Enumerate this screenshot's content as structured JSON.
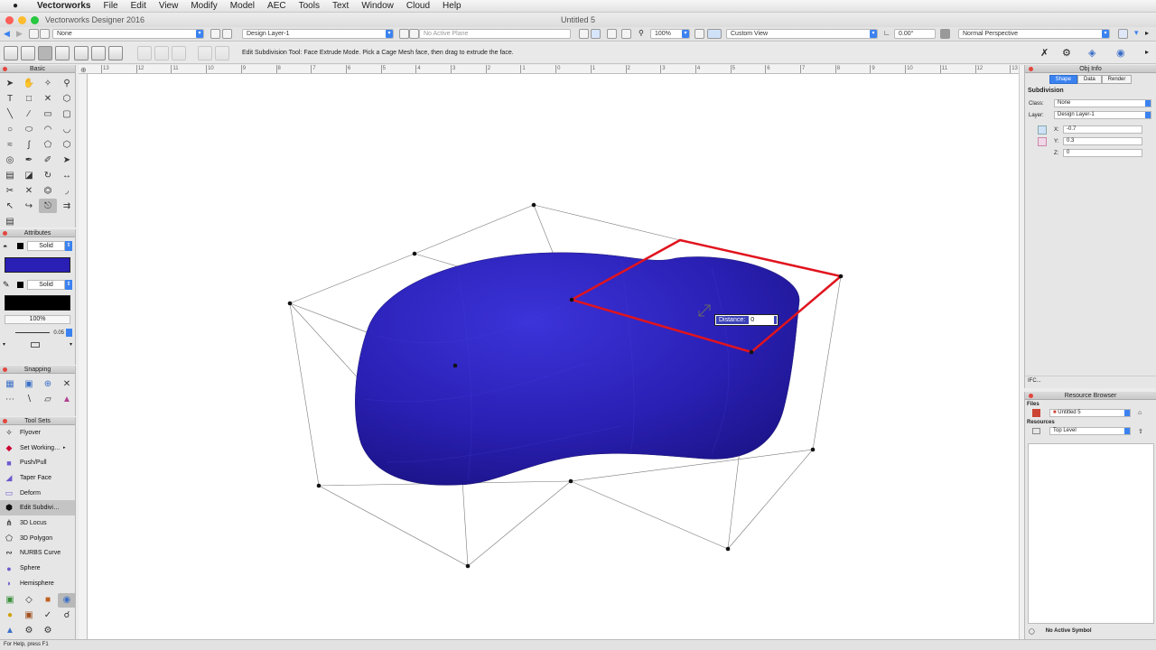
{
  "menubar": {
    "apple": "",
    "app_name": "Vectorworks",
    "items": [
      "File",
      "Edit",
      "View",
      "Modify",
      "Model",
      "AEC",
      "Tools",
      "Text",
      "Window",
      "Cloud",
      "Help"
    ]
  },
  "window": {
    "app_title": "Vectorworks Designer 2016",
    "doc_title": "Untitled 5"
  },
  "viewbar": {
    "class_value": "None",
    "layer_value": "Design Layer-1",
    "plane_value": "No Active Plane",
    "zoom_value": "100%",
    "view_value": "Custom View",
    "angle_value": "0.00°",
    "render_value": "Normal Perspective"
  },
  "modebar": {
    "message": "Edit Subdivision Tool: Face Extrude Mode. Pick a Cage Mesh face, then drag to extrude the face."
  },
  "palettes": {
    "basic_title": "Basic",
    "attributes_title": "Attributes",
    "fill_style": "Solid",
    "pen_style": "Solid",
    "opacity": "100%",
    "line_thickness": "0.05",
    "fill_color": "#2a1fb5",
    "pen_color": "#000000",
    "snapping_title": "Snapping",
    "toolsets_title": "Tool Sets",
    "toolsets": [
      {
        "label": "Flyover",
        "icon": "flyover-icon"
      },
      {
        "label": "Set Working…",
        "icon": "working-plane-icon"
      },
      {
        "label": "Push/Pull",
        "icon": "push-pull-icon"
      },
      {
        "label": "Taper Face",
        "icon": "taper-face-icon"
      },
      {
        "label": "Deform",
        "icon": "deform-icon"
      },
      {
        "label": "Edit Subdivi…",
        "icon": "edit-subdivision-icon"
      },
      {
        "label": "3D Locus",
        "icon": "locus-icon"
      },
      {
        "label": "3D Polygon",
        "icon": "polygon-3d-icon"
      },
      {
        "label": "NURBS Curve",
        "icon": "nurbs-curve-icon"
      },
      {
        "label": "Sphere",
        "icon": "sphere-icon"
      },
      {
        "label": "Hemisphere",
        "icon": "hemisphere-icon"
      }
    ]
  },
  "rulers": {
    "h_ticks": [
      "13",
      "12",
      "11",
      "10",
      "9",
      "8",
      "7",
      "6",
      "5",
      "4",
      "3",
      "2",
      "1",
      "0",
      "1",
      "2",
      "3",
      "4",
      "5",
      "6",
      "7",
      "8",
      "9",
      "10",
      "11",
      "12",
      "13"
    ]
  },
  "canvas": {
    "distance_label": "Distance:",
    "distance_value": "0",
    "shape_color": "#2a1fb5",
    "highlight_color": "#e0141e"
  },
  "obj_info": {
    "title": "Obj Info",
    "tabs": [
      "Shape",
      "Data",
      "Render"
    ],
    "object_type": "Subdivision",
    "class_label": "Class:",
    "class_value": "None",
    "layer_label": "Layer:",
    "layer_value": "Design Layer-1",
    "x_label": "X:",
    "x_value": "-0.7",
    "y_label": "Y:",
    "y_value": "0.3",
    "z_label": "Z:",
    "z_value": "0",
    "ifc_label": "IFC..."
  },
  "resource_browser": {
    "title": "Resource Browser",
    "files_label": "Files",
    "file_value": "Untitled 5",
    "resources_label": "Resources",
    "resources_value": "Top Level",
    "symbol_status": "No Active Symbol"
  },
  "status": {
    "help_text": "For Help, press F1"
  }
}
